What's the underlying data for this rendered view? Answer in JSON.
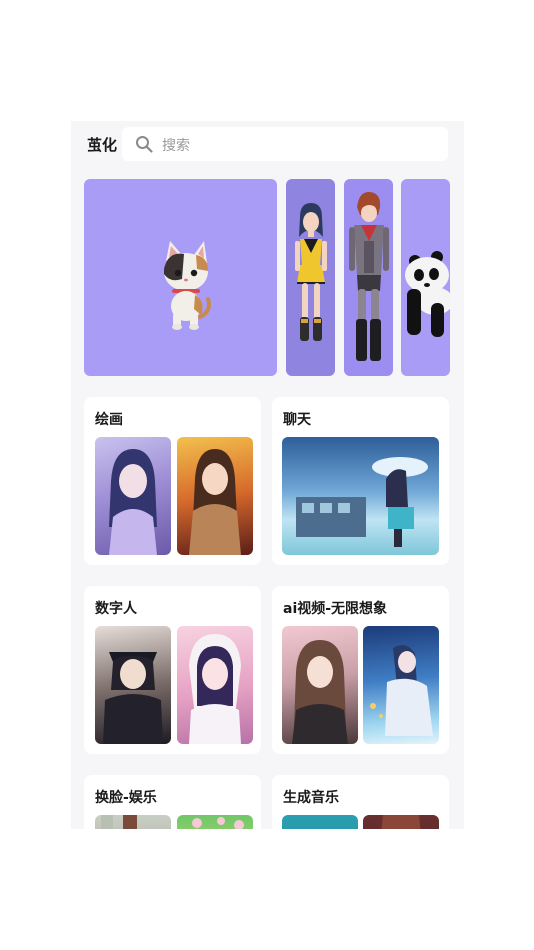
{
  "header": {
    "brand": "茧化",
    "search_placeholder": "搜索",
    "search_icon": "search-icon"
  },
  "banner": {
    "items": [
      {
        "name": "cat",
        "color": "#a99cf6"
      },
      {
        "name": "anime-girl",
        "color": "#8f84df"
      },
      {
        "name": "anime-boy",
        "color": "#9b8ef0"
      },
      {
        "name": "panda",
        "color": "#a99cf6"
      }
    ]
  },
  "cards": [
    {
      "title": "绘画"
    },
    {
      "title": "聊天"
    },
    {
      "title": "数字人"
    },
    {
      "title": "ai视频-无限想象"
    },
    {
      "title": "换脸-娱乐"
    },
    {
      "title": "生成音乐"
    }
  ]
}
